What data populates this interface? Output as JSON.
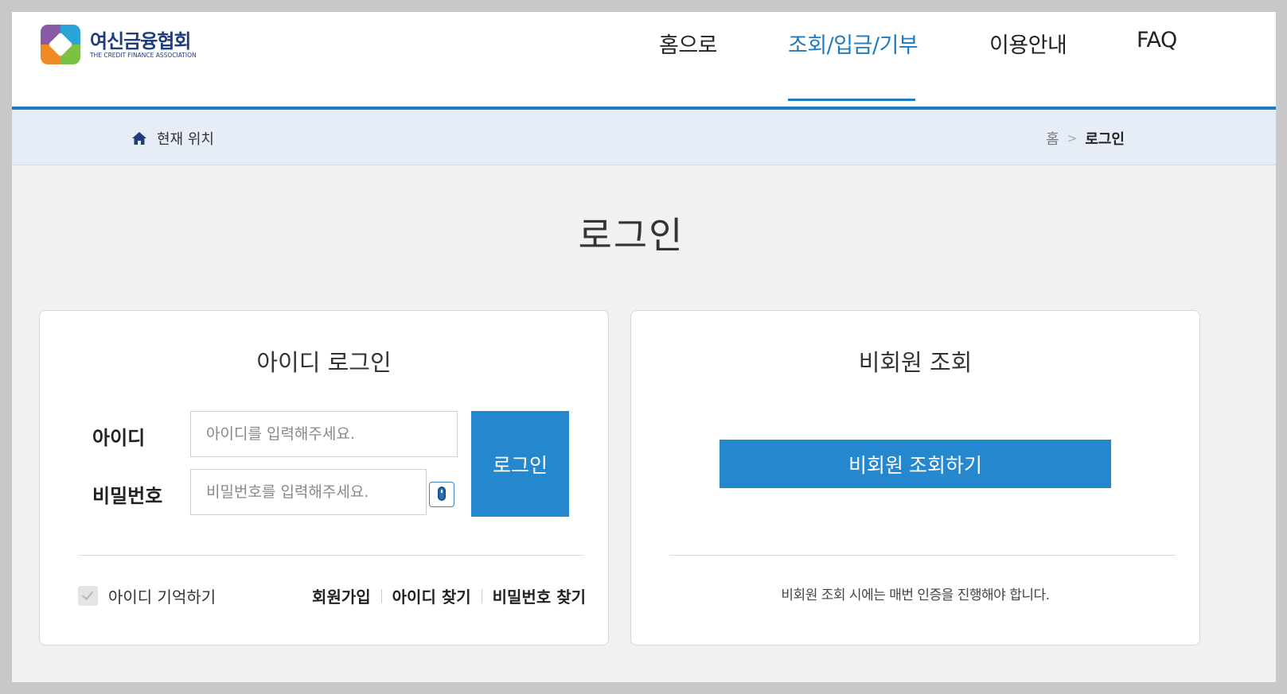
{
  "header": {
    "logo_ko": "여신금융협회",
    "logo_en": "THE CREDIT FINANCE ASSOCIATION",
    "nav": [
      {
        "label": "홈으로",
        "active": false
      },
      {
        "label": "조회/입금/기부",
        "active": true
      },
      {
        "label": "이용안내",
        "active": false
      },
      {
        "label": "FAQ",
        "active": false
      }
    ]
  },
  "breadcrumb": {
    "label": "현재 위치",
    "home": "홈",
    "separator": ">",
    "current": "로그인"
  },
  "page_title": "로그인",
  "id_login": {
    "title": "아이디 로그인",
    "id_label": "아이디",
    "id_placeholder": "아이디를 입력해주세요.",
    "pw_label": "비밀번호",
    "pw_placeholder": "비밀번호를 입력해주세요.",
    "login_button": "로그인",
    "remember_label": "아이디 기억하기",
    "links": [
      "회원가입",
      "아이디 찾기",
      "비밀번호 찾기"
    ]
  },
  "nonmember": {
    "title": "비회원 조회",
    "button": "비회원 조회하기",
    "notice": "비회원 조회 시에는 매번 인증을 진행해야 합니다."
  },
  "colors": {
    "accent": "#2588cf",
    "nav_active": "#1e7bc2",
    "crumb_bg": "#e7edf6",
    "page_bg": "#f1f1f1"
  }
}
